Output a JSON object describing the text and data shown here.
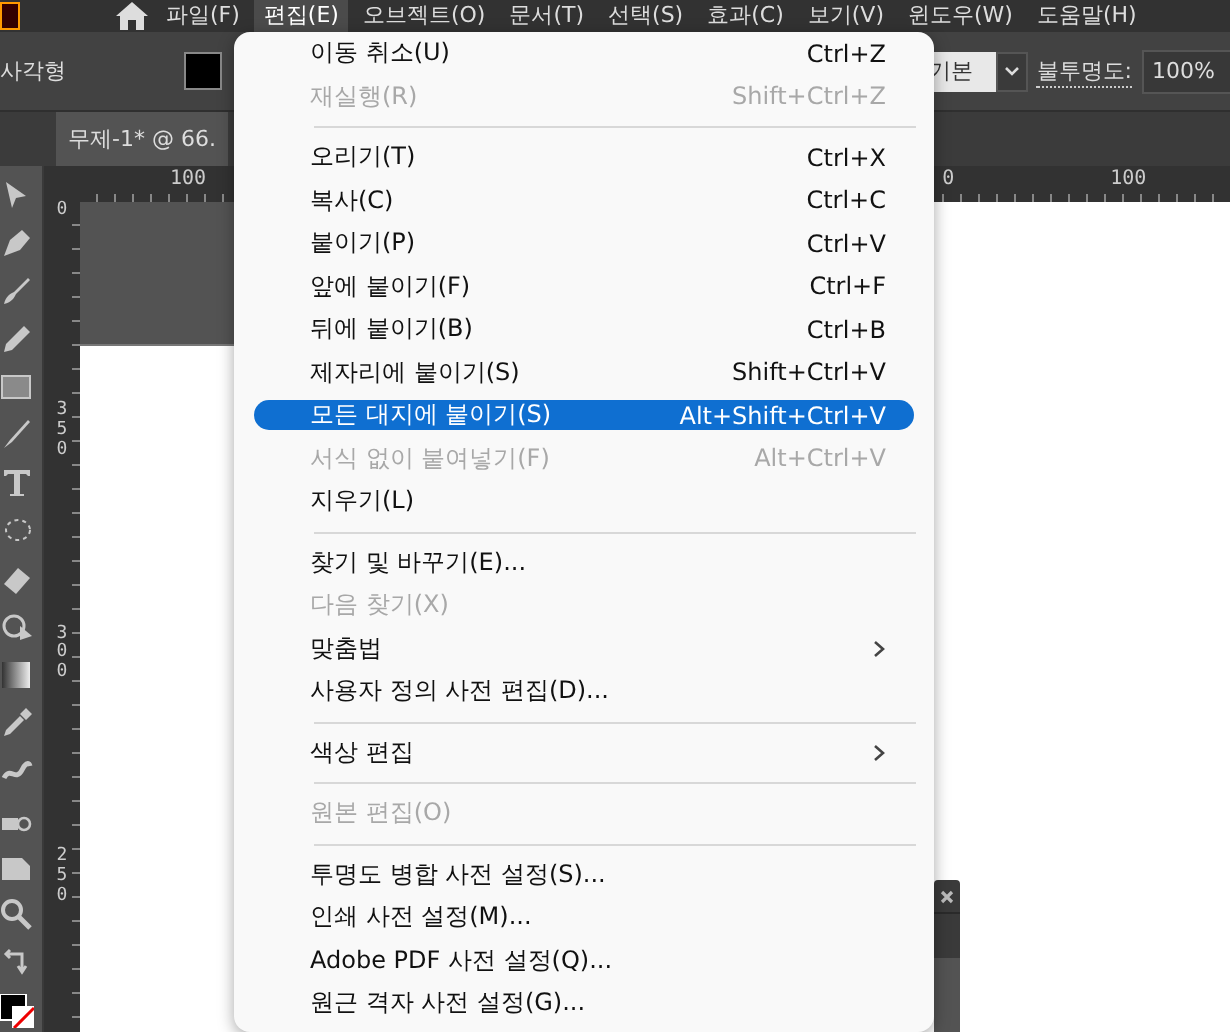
{
  "menubar": [
    {
      "label": "파일(F)",
      "selected": false
    },
    {
      "label": "편집(E)",
      "selected": true
    },
    {
      "label": "오브젝트(O)",
      "selected": false
    },
    {
      "label": "문서(T)",
      "selected": false
    },
    {
      "label": "선택(S)",
      "selected": false
    },
    {
      "label": "효과(C)",
      "selected": false
    },
    {
      "label": "보기(V)",
      "selected": false
    },
    {
      "label": "윈도우(W)",
      "selected": false
    },
    {
      "label": "도움말(H)",
      "selected": false
    }
  ],
  "control_bar": {
    "tool_name": "사각형",
    "stroke_style": "기본",
    "opacity_label": "불투명도:",
    "opacity_value": "100%"
  },
  "document_tab": {
    "title": "무제-1* @ 66."
  },
  "horizontal_ruler": [
    "100",
    "0",
    "100"
  ],
  "vertical_ruler": [
    "0",
    "350",
    "300",
    "250"
  ],
  "edit_menu": [
    {
      "kind": "item",
      "label": "이동 취소(U)",
      "shortcut": "Ctrl+Z",
      "disabled": false,
      "selected": false
    },
    {
      "kind": "item",
      "label": "재실행(R)",
      "shortcut": "Shift+Ctrl+Z",
      "disabled": true,
      "selected": false
    },
    {
      "kind": "separator"
    },
    {
      "kind": "item",
      "label": "오리기(T)",
      "shortcut": "Ctrl+X",
      "disabled": false,
      "selected": false
    },
    {
      "kind": "item",
      "label": "복사(C)",
      "shortcut": "Ctrl+C",
      "disabled": false,
      "selected": false
    },
    {
      "kind": "item",
      "label": "붙이기(P)",
      "shortcut": "Ctrl+V",
      "disabled": false,
      "selected": false
    },
    {
      "kind": "item",
      "label": "앞에 붙이기(F)",
      "shortcut": "Ctrl+F",
      "disabled": false,
      "selected": false
    },
    {
      "kind": "item",
      "label": "뒤에 붙이기(B)",
      "shortcut": "Ctrl+B",
      "disabled": false,
      "selected": false
    },
    {
      "kind": "item",
      "label": "제자리에 붙이기(S)",
      "shortcut": "Shift+Ctrl+V",
      "disabled": false,
      "selected": false
    },
    {
      "kind": "item",
      "label": "모든 대지에 붙이기(S)",
      "shortcut": "Alt+Shift+Ctrl+V",
      "disabled": false,
      "selected": true
    },
    {
      "kind": "item",
      "label": "서식 없이 붙여넣기(F)",
      "shortcut": "Alt+Ctrl+V",
      "disabled": true,
      "selected": false
    },
    {
      "kind": "item",
      "label": "지우기(L)",
      "disabled": false,
      "selected": false
    },
    {
      "kind": "separator"
    },
    {
      "kind": "item",
      "label": "찾기 및 바꾸기(E)...",
      "disabled": false,
      "selected": false
    },
    {
      "kind": "item",
      "label": "다음 찾기(X)",
      "disabled": true,
      "selected": false
    },
    {
      "kind": "submenu",
      "label": "맞춤법",
      "disabled": false,
      "selected": false
    },
    {
      "kind": "item",
      "label": "사용자 정의 사전 편집(D)...",
      "disabled": false,
      "selected": false
    },
    {
      "kind": "separator"
    },
    {
      "kind": "submenu",
      "label": "색상 편집",
      "disabled": false,
      "selected": false
    },
    {
      "kind": "separator"
    },
    {
      "kind": "item",
      "label": "원본 편집(O)",
      "disabled": true,
      "selected": false
    },
    {
      "kind": "separator"
    },
    {
      "kind": "item",
      "label": "투명도 병합 사전 설정(S)...",
      "disabled": false,
      "selected": false
    },
    {
      "kind": "item",
      "label": "인쇄 사전 설정(M)...",
      "disabled": false,
      "selected": false
    },
    {
      "kind": "item",
      "label": "Adobe PDF 사전 설정(Q)...",
      "disabled": false,
      "selected": false
    },
    {
      "kind": "item",
      "label": "원근 격자 사전 설정(G)...",
      "disabled": false,
      "selected": false
    }
  ]
}
